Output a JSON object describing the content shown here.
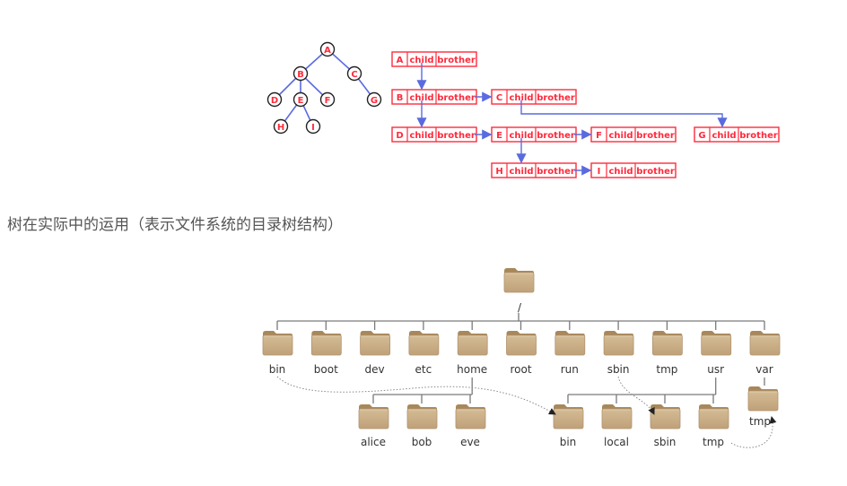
{
  "binary_tree_figure": {
    "tree_nodes": [
      {
        "id": "A",
        "parent": null
      },
      {
        "id": "B",
        "parent": "A"
      },
      {
        "id": "C",
        "parent": "A"
      },
      {
        "id": "D",
        "parent": "B"
      },
      {
        "id": "E",
        "parent": "B"
      },
      {
        "id": "F",
        "parent": "B"
      },
      {
        "id": "G",
        "parent": "C"
      },
      {
        "id": "H",
        "parent": "E"
      },
      {
        "id": "I",
        "parent": "E"
      }
    ],
    "child_brother_nodes": [
      {
        "id": "A",
        "child": "B",
        "brother": null
      },
      {
        "id": "B",
        "child": "D",
        "brother": "C"
      },
      {
        "id": "C",
        "child": "G",
        "brother": null
      },
      {
        "id": "D",
        "child": null,
        "brother": "E"
      },
      {
        "id": "E",
        "child": "H",
        "brother": "F"
      },
      {
        "id": "F",
        "child": null,
        "brother": null
      },
      {
        "id": "G",
        "child": null,
        "brother": null
      },
      {
        "id": "H",
        "child": null,
        "brother": "I"
      },
      {
        "id": "I",
        "child": null,
        "brother": null
      }
    ],
    "field_labels": {
      "child": "child",
      "brother": "brother"
    },
    "colors": {
      "node_red": "#ff2a3c",
      "edge_blue": "#5a6be0"
    }
  },
  "caption": "树在实际中的运用（表示文件系统的目录树结构）",
  "directory_tree": {
    "root": "/",
    "level1": [
      "bin",
      "boot",
      "dev",
      "etc",
      "home",
      "root",
      "run",
      "sbin",
      "tmp",
      "usr",
      "var"
    ],
    "home_children": [
      "alice",
      "bob",
      "eve"
    ],
    "usr_children": [
      "bin",
      "local",
      "sbin",
      "tmp"
    ],
    "var_children": [
      "tmp"
    ],
    "links": [
      {
        "from": "/bin",
        "to": "/usr/bin"
      },
      {
        "from": "/sbin",
        "to": "/usr/sbin"
      },
      {
        "from": "/usr/tmp",
        "to": "/var/tmp"
      }
    ],
    "colors": {
      "folder": "#c8ad85",
      "folder_dark": "#a88a5c",
      "line": "#7a7a7a"
    }
  }
}
